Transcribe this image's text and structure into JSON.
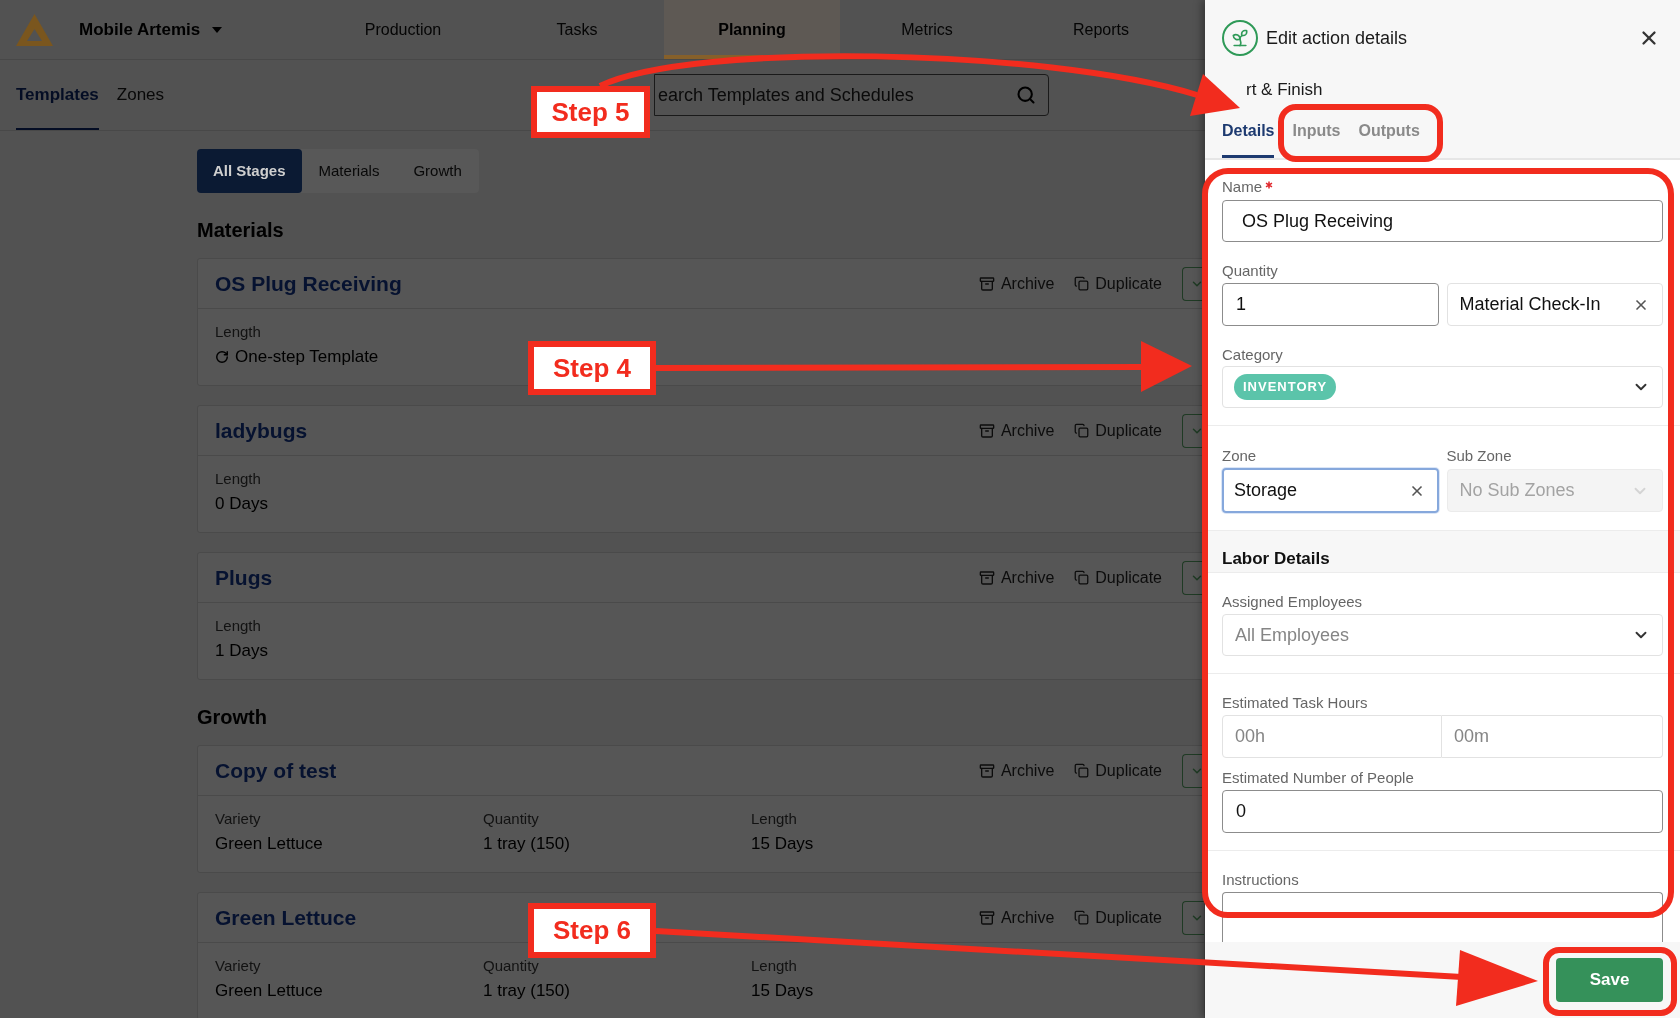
{
  "app": {
    "name": "Mobile Artemis"
  },
  "nav": [
    {
      "label": "Production",
      "selected": false
    },
    {
      "label": "Tasks",
      "selected": false
    },
    {
      "label": "Planning",
      "selected": true
    },
    {
      "label": "Metrics",
      "selected": false
    },
    {
      "label": "Reports",
      "selected": false
    }
  ],
  "subnav": {
    "tabs": [
      {
        "label": "Templates",
        "selected": true
      },
      {
        "label": "Zones",
        "selected": false
      }
    ],
    "search": {
      "placeholder": "earch Templates and Schedules"
    }
  },
  "stage_filter": [
    {
      "label": "All Stages",
      "selected": true
    },
    {
      "label": "Materials",
      "selected": false
    },
    {
      "label": "Growth",
      "selected": false
    }
  ],
  "sections": [
    {
      "title": "Materials",
      "templates": [
        {
          "title": "OS Plug Receiving",
          "actions": [
            {
              "kind": "archive",
              "label": "Archive"
            },
            {
              "kind": "duplicate",
              "label": "Duplicate"
            }
          ],
          "fields": [
            {
              "kind": "one_step",
              "label": "Length",
              "value": "One-step Template"
            }
          ]
        },
        {
          "title": "ladybugs",
          "actions": [
            {
              "kind": "archive",
              "label": "Archive"
            },
            {
              "kind": "duplicate",
              "label": "Duplicate"
            }
          ],
          "fields": [
            {
              "kind": "plain",
              "label": "Length",
              "value": "0 Days"
            }
          ]
        },
        {
          "title": "Plugs",
          "actions": [
            {
              "kind": "archive",
              "label": "Archive"
            },
            {
              "kind": "duplicate",
              "label": "Duplicate"
            }
          ],
          "fields": [
            {
              "kind": "plain",
              "label": "Length",
              "value": "1 Days"
            }
          ]
        }
      ]
    },
    {
      "title": "Growth",
      "templates": [
        {
          "title": "Copy of test",
          "actions": [
            {
              "kind": "archive",
              "label": "Archive"
            },
            {
              "kind": "duplicate",
              "label": "Duplicate"
            }
          ],
          "fields": [
            {
              "kind": "plain",
              "label": "Variety",
              "value": "Green Lettuce"
            },
            {
              "kind": "plain",
              "label": "Quantity",
              "value": "1 tray (150)"
            },
            {
              "kind": "plain",
              "label": "Length",
              "value": "15 Days"
            }
          ]
        },
        {
          "title": "Green Lettuce",
          "actions": [
            {
              "kind": "archive",
              "label": "Archive"
            },
            {
              "kind": "duplicate",
              "label": "Duplicate"
            }
          ],
          "fields": [
            {
              "kind": "plain",
              "label": "Variety",
              "value": "Green Lettuce"
            },
            {
              "kind": "plain",
              "label": "Quantity",
              "value": "1 tray (150)"
            },
            {
              "kind": "plain",
              "label": "Length",
              "value": "15 Days"
            }
          ]
        }
      ]
    }
  ],
  "panel": {
    "title": "Edit action details",
    "subtitle": "rt & Finish",
    "tabs": [
      {
        "label": "Details",
        "selected": true
      },
      {
        "label": "Inputs",
        "selected": false
      },
      {
        "label": "Outputs",
        "selected": false
      }
    ],
    "name": {
      "label": "Name",
      "required": true,
      "value": "OS Plug Receiving"
    },
    "quantity": {
      "label": "Quantity",
      "value": "1",
      "unit": "Material Check-In"
    },
    "category": {
      "label": "Category",
      "value": "INVENTORY"
    },
    "zone": {
      "label": "Zone",
      "value": "Storage",
      "focused": true
    },
    "sub_zone": {
      "label": "Sub Zone",
      "value": "No Sub Zones",
      "disabled": true
    },
    "labor": {
      "title": "Labor Details",
      "assigned": {
        "label": "Assigned Employees",
        "placeholder": "All Employees"
      },
      "task_hours": {
        "label": "Estimated Task Hours",
        "hours_placeholder": "00h",
        "minutes_placeholder": "00m"
      },
      "people": {
        "label": "Estimated Number of People",
        "value": "0"
      }
    },
    "instructions": {
      "label": "Instructions"
    },
    "save": "Save"
  },
  "annotations": [
    {
      "label": "Step 5"
    },
    {
      "label": "Step 4"
    },
    {
      "label": "Step 6"
    }
  ]
}
